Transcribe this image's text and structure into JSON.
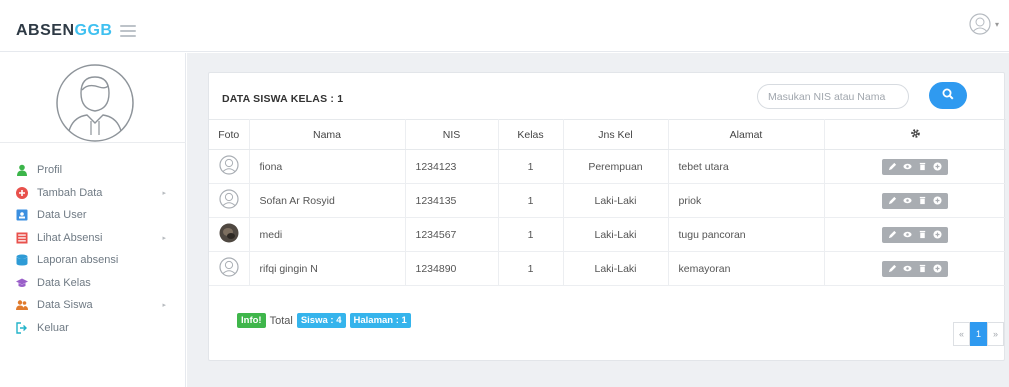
{
  "app": {
    "brand_main": "ABSEN",
    "brand_accent": "GGB",
    "accent_color": "#3fc0f0"
  },
  "header": {
    "menu_icon": "hamburger-icon",
    "user_icon": "user-avatar-icon",
    "caret": "▾"
  },
  "sidebar": {
    "items": [
      {
        "label": "Profil",
        "icon": "person-icon",
        "color": "#3cb54a",
        "has_arrow": false
      },
      {
        "label": "Tambah Data",
        "icon": "plus-circle-icon",
        "color": "#e8514c",
        "has_arrow": true
      },
      {
        "label": "Data User",
        "icon": "id-card-icon",
        "color": "#3b8fe0",
        "has_arrow": false
      },
      {
        "label": "Lihat Absensi",
        "icon": "list-icon",
        "color": "#e8514c",
        "has_arrow": true
      },
      {
        "label": "Laporan absensi",
        "icon": "database-icon",
        "color": "#2e9bd6",
        "has_arrow": false
      },
      {
        "label": "Data Kelas",
        "icon": "graduation-cap-icon",
        "color": "#9a5fc9",
        "has_arrow": false
      },
      {
        "label": "Data Siswa",
        "icon": "users-icon",
        "color": "#e07a2c",
        "has_arrow": true
      },
      {
        "label": "Keluar",
        "icon": "sign-out-icon",
        "color": "#23b3c9",
        "has_arrow": false
      }
    ],
    "arrow": "▸"
  },
  "panel": {
    "title": "DATA SISWA KELAS : 1",
    "search_placeholder": "Masukan NIS atau Nama",
    "search_value": ""
  },
  "table": {
    "headers": [
      "Foto",
      "Nama",
      "NIS",
      "Kelas",
      "Jns Kel",
      "Alamat"
    ],
    "settings_icon": "gear-icon",
    "rows": [
      {
        "nama": "fiona",
        "nis": "1234123",
        "kelas": "1",
        "jk": "Perempuan",
        "alamat": "tebet utara",
        "foto": "default-avatar"
      },
      {
        "nama": "Sofan Ar Rosyid",
        "nis": "1234135",
        "kelas": "1",
        "jk": "Laki-Laki",
        "alamat": "priok",
        "foto": "default-avatar"
      },
      {
        "nama": "medi",
        "nis": "1234567",
        "kelas": "1",
        "jk": "Laki-Laki",
        "alamat": "tugu pancoran",
        "foto": "photo"
      },
      {
        "nama": "rifqi gingin N",
        "nis": "1234890",
        "kelas": "1",
        "jk": "Laki-Laki",
        "alamat": "kemayoran",
        "foto": "default-avatar"
      }
    ],
    "row_actions": [
      "edit-icon",
      "view-icon",
      "delete-icon",
      "add-icon"
    ]
  },
  "footer": {
    "info_badge": "Info!",
    "total_text": "Total",
    "siswa_badge": "Siswa : 4",
    "halaman_badge": "Halaman : 1"
  },
  "pagination": {
    "prev": "«",
    "current": "1",
    "next": "»"
  }
}
